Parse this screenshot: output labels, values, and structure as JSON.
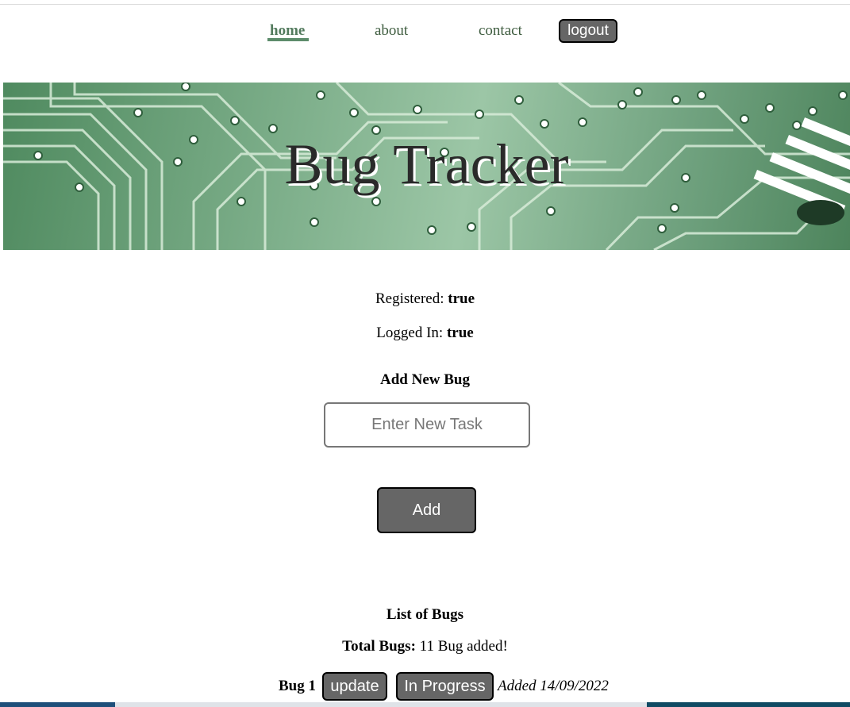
{
  "nav": {
    "home": "home",
    "about": "about",
    "contact": "contact",
    "logout": "logout"
  },
  "banner": {
    "title": "Bug Tracker"
  },
  "status": {
    "registered_label": "Registered:",
    "registered_value": "true",
    "logged_label": "Logged In:",
    "logged_value": "true"
  },
  "add": {
    "heading": "Add New Bug",
    "placeholder": "Enter New Task",
    "button": "Add"
  },
  "list": {
    "heading": "List of Bugs",
    "total_label": "Total Bugs:",
    "total_text": "11 Bug added!",
    "bugs": [
      {
        "name": "Bug 1",
        "update_label": "update",
        "status_label": "In Progress",
        "added_text": "Added 14/09/2022"
      }
    ]
  },
  "colors": {
    "nav_text": "#3e5c3f",
    "nav_active": "#527a5d",
    "button_bg": "#666666",
    "banner_green": "#7fb08c"
  }
}
